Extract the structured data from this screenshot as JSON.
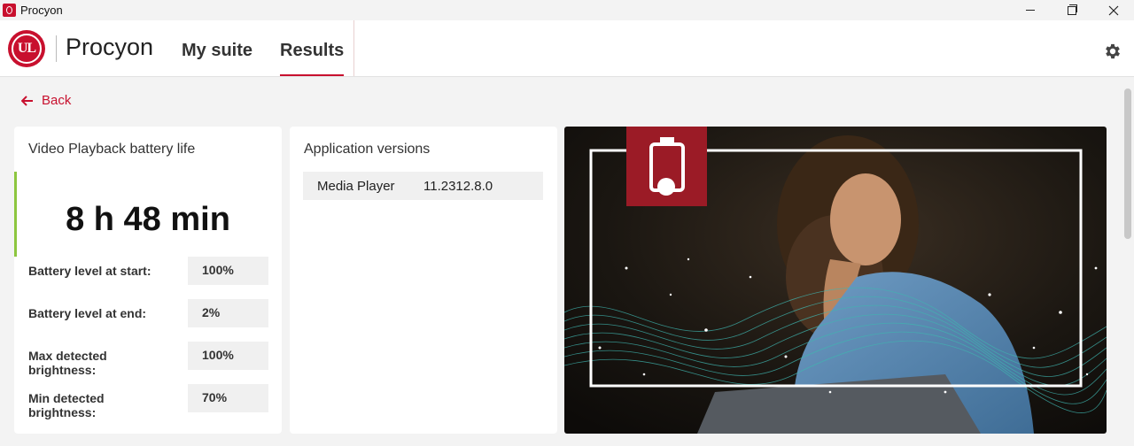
{
  "window": {
    "title": "Procyon",
    "minimize_icon": "minimize-icon",
    "maximize_icon": "restore-icon",
    "close_icon": "close-icon"
  },
  "header": {
    "logo_text": "UL",
    "brand": "Procyon",
    "tabs": [
      {
        "label": "My suite",
        "active": false
      },
      {
        "label": "Results",
        "active": true
      }
    ],
    "settings_icon": "gear-icon"
  },
  "back": {
    "label": "Back",
    "icon": "arrow-left-icon"
  },
  "battery_card": {
    "title": "Video Playback battery life",
    "duration": "8 h 48 min",
    "stats": [
      {
        "label": "Battery level at start:",
        "value": "100%"
      },
      {
        "label": "Battery level at end:",
        "value": "2%"
      },
      {
        "label": "Max detected brightness:",
        "value": "100%"
      },
      {
        "label": "Min detected brightness:",
        "value": "70%"
      }
    ]
  },
  "apps_card": {
    "title": "Application versions",
    "apps": [
      {
        "name": "Media Player",
        "version": "11.2312.8.0"
      }
    ]
  },
  "image_card": {
    "badge_icon": "battery-icon"
  },
  "colors": {
    "accent": "#c8102e",
    "success": "#8dc63f"
  }
}
